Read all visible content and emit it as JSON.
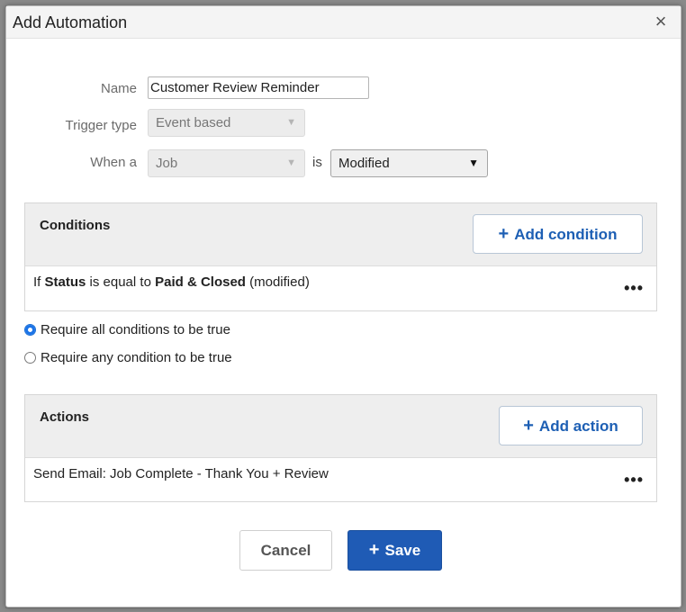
{
  "dialog": {
    "title": "Add Automation",
    "close_symbol": "×"
  },
  "form": {
    "name_label": "Name",
    "name_value": "Customer Review Reminder",
    "trigger_label": "Trigger type",
    "trigger_value": "Event based",
    "when_label": "When a",
    "when_value": "Job",
    "is_label": "is",
    "event_value": "Modified",
    "dropdown_arrow": "▼"
  },
  "conditions": {
    "title": "Conditions",
    "add_label": "Add condition",
    "plus": "+",
    "row": {
      "prefix": "If",
      "field": "Status",
      "operator": "is equal to",
      "value": "Paid & Closed",
      "suffix": "(modified)"
    },
    "more": "•••"
  },
  "require": {
    "all_label": "Require all conditions to be true",
    "any_label": "Require any condition to be true",
    "selected": "all"
  },
  "actions": {
    "title": "Actions",
    "add_label": "Add action",
    "plus": "+",
    "row_text": "Send Email: Job Complete - Thank You + Review",
    "more": "•••"
  },
  "footer": {
    "cancel_label": "Cancel",
    "save_label": "Save",
    "plus": "+"
  },
  "colors": {
    "primary": "#1f5bb5",
    "link": "#1d5fb4",
    "radio": "#1a73e8"
  }
}
